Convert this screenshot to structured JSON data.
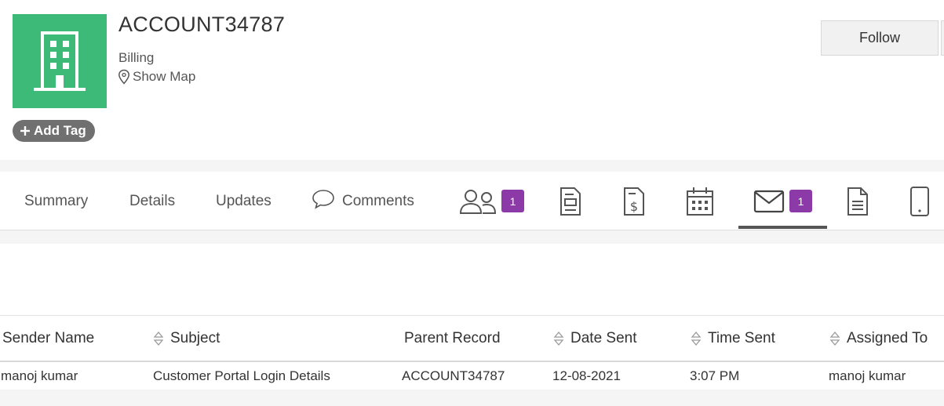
{
  "account": {
    "name": "ACCOUNT34787",
    "type": "Billing",
    "show_map_label": "Show Map",
    "add_tag_label": "Add Tag",
    "follow_label": "Follow",
    "logo_color": "#3dba78"
  },
  "tabs": {
    "summary": "Summary",
    "details": "Details",
    "updates": "Updates",
    "comments": "Comments",
    "contacts_badge": "1",
    "emails_badge": "1",
    "active": "emails"
  },
  "icons": [
    "building-icon",
    "map-pin-icon",
    "plus-icon",
    "comment-icon",
    "contacts-icon",
    "invoice-icon",
    "quote-icon",
    "calendar-icon",
    "email-icon",
    "document-icon",
    "mobile-icon",
    "sort-icon"
  ],
  "table": {
    "headers": [
      "Sender Name",
      "Subject",
      "Parent Record",
      "Date Sent",
      "Time Sent",
      "Assigned To"
    ],
    "rows": [
      [
        "manoj kumar",
        "Customer Portal Login Details",
        "ACCOUNT34787",
        "12-08-2021",
        "3:07 PM",
        "manoj kumar"
      ]
    ]
  },
  "colors": {
    "badge": "#8c3aa8",
    "tag_bg": "#707070"
  }
}
